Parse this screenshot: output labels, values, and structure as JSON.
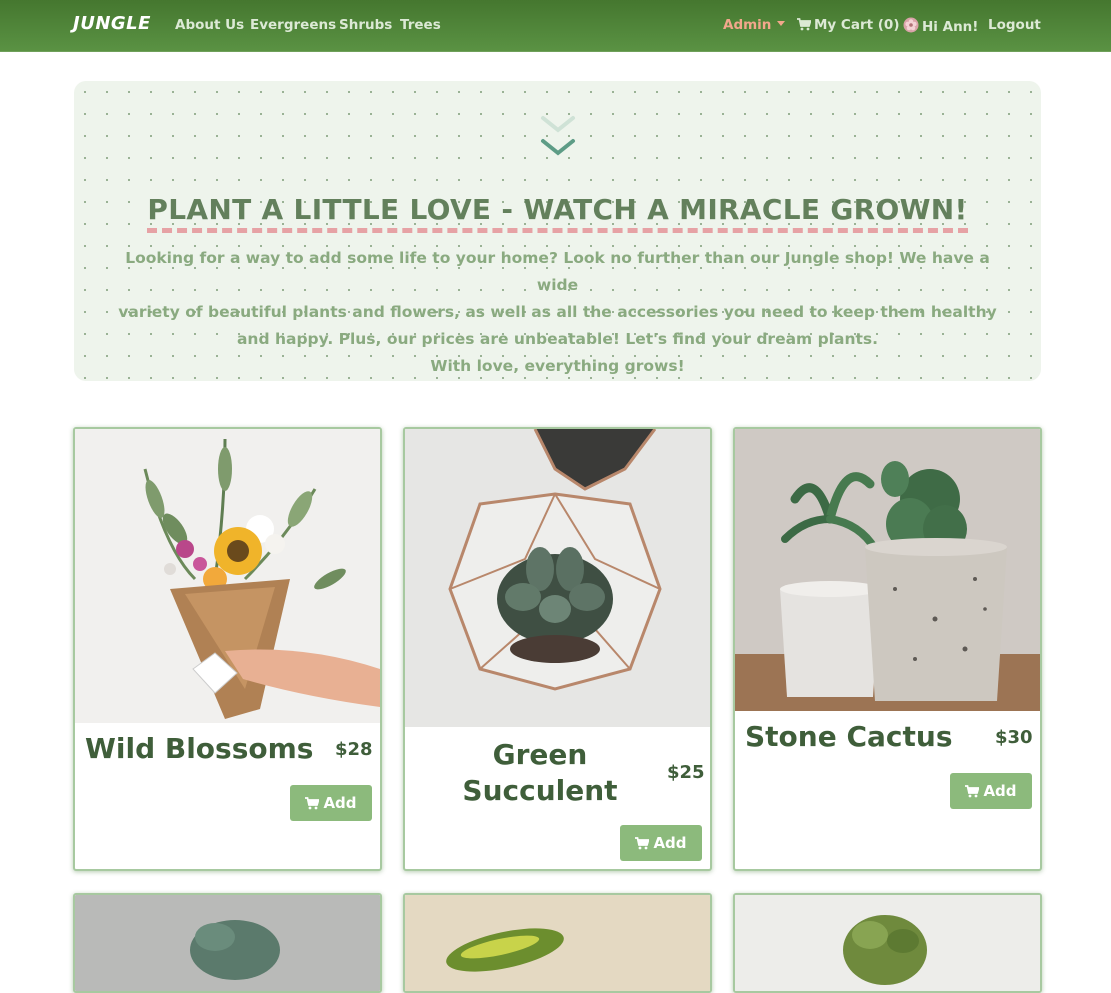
{
  "navbar": {
    "brand": "JUNGLE",
    "links": [
      "About Us",
      "Evergreens",
      "Shrubs",
      "Trees"
    ],
    "admin": "Admin",
    "cart": "My Cart (0)",
    "greeting": "Hi Ann!",
    "logout": "Logout",
    "colors": {
      "bar": "#4f8439",
      "admin": "#f2a78c"
    }
  },
  "hero": {
    "title": "PLANT A LITTLE LOVE - WATCH A MIRACLE GROWN!",
    "lines": [
      "Looking for a way to add some life to your home? Look no further than our Jungle shop! We have a wide",
      "variety of beautiful plants and flowers, as well as all the accessories you need to keep them healthy",
      "and happy. Plus, our prices are unbeatable! Let's find your dream plants.",
      "With love, everything grows!"
    ]
  },
  "products": [
    {
      "name": "Wild Blossoms",
      "price": "$28",
      "button": "Add"
    },
    {
      "name": "Green Succulent",
      "price": "$25",
      "button": "Add"
    },
    {
      "name": "Stone Cactus",
      "price": "$30",
      "button": "Add"
    }
  ],
  "icons": {
    "cart": "cart-icon",
    "avatar": "flower-avatar-icon",
    "hero": "double-chevron-down-icon"
  }
}
